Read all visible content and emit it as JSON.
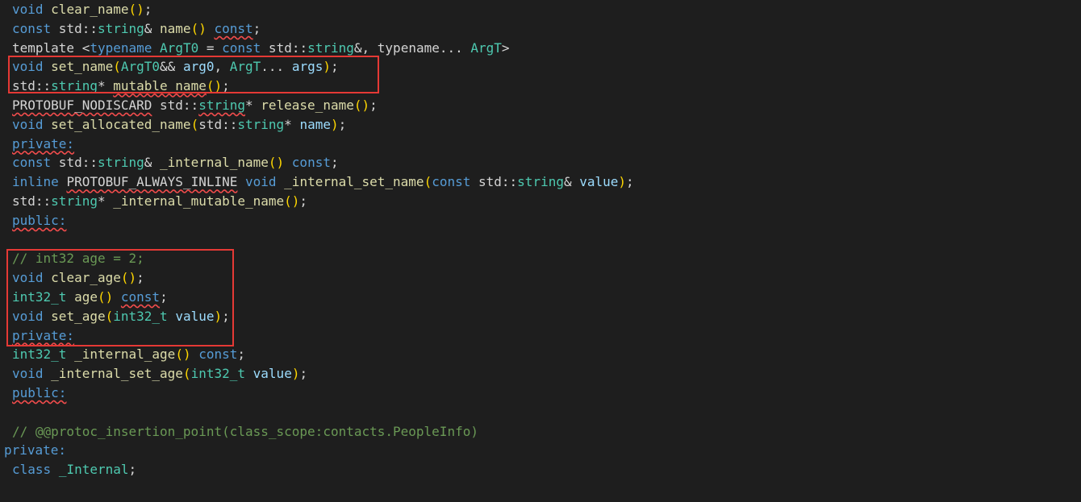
{
  "colors": {
    "background": "#1e1e1e",
    "keyword": "#569cd6",
    "type": "#4ec9b0",
    "function": "#dcdcaa",
    "variable": "#9cdcfe",
    "number": "#b5cea8",
    "comment": "#6a9955",
    "plain": "#d4d4d4",
    "bracket": "#ffd700",
    "bracket_nested": "#da70d6",
    "highlight_box": "#e53935",
    "squiggle": "#f14c4c"
  },
  "code_lines": [
    {
      "indent": 1,
      "tokens": [
        {
          "t": "void",
          "c": "kw"
        },
        {
          "t": " ",
          "c": "plain"
        },
        {
          "t": "clear_name",
          "c": "fn"
        },
        {
          "t": "()",
          "c": "paren"
        },
        {
          "t": ";",
          "c": "plain"
        }
      ]
    },
    {
      "indent": 1,
      "tokens": [
        {
          "t": "const",
          "c": "kw"
        },
        {
          "t": " std::",
          "c": "plain"
        },
        {
          "t": "string",
          "c": "type"
        },
        {
          "t": "& ",
          "c": "plain"
        },
        {
          "t": "name",
          "c": "fn"
        },
        {
          "t": "()",
          "c": "paren"
        },
        {
          "t": " ",
          "c": "plain"
        },
        {
          "t": "const",
          "c": "kw",
          "s": true
        },
        {
          "t": ";",
          "c": "plain"
        }
      ]
    },
    {
      "indent": 1,
      "tokens": [
        {
          "t": "template ",
          "c": "plain"
        },
        {
          "t": "<",
          "c": "plain"
        },
        {
          "t": "typename",
          "c": "kw"
        },
        {
          "t": " ",
          "c": "plain"
        },
        {
          "t": "ArgT0",
          "c": "type"
        },
        {
          "t": " = ",
          "c": "plain"
        },
        {
          "t": "const",
          "c": "kw"
        },
        {
          "t": " std::",
          "c": "plain"
        },
        {
          "t": "string",
          "c": "type"
        },
        {
          "t": "&, typename... ",
          "c": "plain"
        },
        {
          "t": "ArgT",
          "c": "type"
        },
        {
          "t": ">",
          "c": "plain"
        }
      ]
    },
    {
      "indent": 1,
      "tokens": [
        {
          "t": "void",
          "c": "kw"
        },
        {
          "t": " ",
          "c": "plain"
        },
        {
          "t": "set_name",
          "c": "fn"
        },
        {
          "t": "(",
          "c": "paren"
        },
        {
          "t": "ArgT0",
          "c": "type"
        },
        {
          "t": "&& ",
          "c": "plain"
        },
        {
          "t": "arg0",
          "c": "var"
        },
        {
          "t": ", ",
          "c": "plain"
        },
        {
          "t": "ArgT",
          "c": "type"
        },
        {
          "t": "... ",
          "c": "plain"
        },
        {
          "t": "args",
          "c": "var"
        },
        {
          "t": ")",
          "c": "paren"
        },
        {
          "t": ";",
          "c": "plain"
        }
      ]
    },
    {
      "indent": 1,
      "tokens": [
        {
          "t": "std::",
          "c": "plain"
        },
        {
          "t": "string",
          "c": "type"
        },
        {
          "t": "* ",
          "c": "plain"
        },
        {
          "t": "mutable_name",
          "c": "fn",
          "s": true
        },
        {
          "t": "()",
          "c": "paren"
        },
        {
          "t": ";",
          "c": "plain"
        }
      ]
    },
    {
      "indent": 1,
      "tokens": [
        {
          "t": "PROTOBUF_NODISCARD",
          "c": "plain",
          "s": true
        },
        {
          "t": " std::",
          "c": "plain"
        },
        {
          "t": "string",
          "c": "type",
          "s": true
        },
        {
          "t": "* ",
          "c": "plain"
        },
        {
          "t": "release_name",
          "c": "fn"
        },
        {
          "t": "()",
          "c": "paren"
        },
        {
          "t": ";",
          "c": "plain"
        }
      ]
    },
    {
      "indent": 1,
      "tokens": [
        {
          "t": "void",
          "c": "kw"
        },
        {
          "t": " ",
          "c": "plain"
        },
        {
          "t": "set_allocated_name",
          "c": "fn"
        },
        {
          "t": "(",
          "c": "paren"
        },
        {
          "t": "std::",
          "c": "plain"
        },
        {
          "t": "string",
          "c": "type"
        },
        {
          "t": "* ",
          "c": "plain"
        },
        {
          "t": "name",
          "c": "var"
        },
        {
          "t": ")",
          "c": "paren"
        },
        {
          "t": ";",
          "c": "plain"
        }
      ]
    },
    {
      "indent": 1,
      "tokens": [
        {
          "t": "private:",
          "c": "kw",
          "s": true
        }
      ]
    },
    {
      "indent": 1,
      "tokens": [
        {
          "t": "const",
          "c": "kw"
        },
        {
          "t": " std::",
          "c": "plain"
        },
        {
          "t": "string",
          "c": "type"
        },
        {
          "t": "& ",
          "c": "plain"
        },
        {
          "t": "_internal_name",
          "c": "fn"
        },
        {
          "t": "()",
          "c": "paren"
        },
        {
          "t": " ",
          "c": "plain"
        },
        {
          "t": "const",
          "c": "kw"
        },
        {
          "t": ";",
          "c": "plain"
        }
      ]
    },
    {
      "indent": 1,
      "tokens": [
        {
          "t": "inline",
          "c": "kw"
        },
        {
          "t": " ",
          "c": "plain"
        },
        {
          "t": "PROTOBUF_ALWAYS_INLINE",
          "c": "plain",
          "s": true
        },
        {
          "t": " ",
          "c": "plain"
        },
        {
          "t": "void",
          "c": "kw"
        },
        {
          "t": " ",
          "c": "plain"
        },
        {
          "t": "_internal_set_name",
          "c": "fn"
        },
        {
          "t": "(",
          "c": "paren"
        },
        {
          "t": "const",
          "c": "kw"
        },
        {
          "t": " std::",
          "c": "plain"
        },
        {
          "t": "string",
          "c": "type"
        },
        {
          "t": "& ",
          "c": "plain"
        },
        {
          "t": "value",
          "c": "var"
        },
        {
          "t": ")",
          "c": "paren"
        },
        {
          "t": ";",
          "c": "plain"
        }
      ]
    },
    {
      "indent": 1,
      "tokens": [
        {
          "t": "std::",
          "c": "plain"
        },
        {
          "t": "string",
          "c": "type"
        },
        {
          "t": "* ",
          "c": "plain"
        },
        {
          "t": "_internal_mutable_name",
          "c": "fn"
        },
        {
          "t": "()",
          "c": "paren"
        },
        {
          "t": ";",
          "c": "plain"
        }
      ]
    },
    {
      "indent": 1,
      "tokens": [
        {
          "t": "public:",
          "c": "kw",
          "s": true
        }
      ]
    },
    {
      "indent": 0,
      "tokens": []
    },
    {
      "indent": 1,
      "tokens": [
        {
          "t": "// int32 age = 2;",
          "c": "cmt"
        }
      ]
    },
    {
      "indent": 1,
      "tokens": [
        {
          "t": "void",
          "c": "kw"
        },
        {
          "t": " ",
          "c": "plain"
        },
        {
          "t": "clear_age",
          "c": "fn"
        },
        {
          "t": "()",
          "c": "paren"
        },
        {
          "t": ";",
          "c": "plain"
        }
      ]
    },
    {
      "indent": 1,
      "tokens": [
        {
          "t": "int32_t",
          "c": "type"
        },
        {
          "t": " ",
          "c": "plain"
        },
        {
          "t": "age",
          "c": "fn"
        },
        {
          "t": "()",
          "c": "paren"
        },
        {
          "t": " ",
          "c": "plain"
        },
        {
          "t": "const",
          "c": "kw",
          "s": true
        },
        {
          "t": ";",
          "c": "plain"
        }
      ]
    },
    {
      "indent": 1,
      "tokens": [
        {
          "t": "void",
          "c": "kw"
        },
        {
          "t": " ",
          "c": "plain"
        },
        {
          "t": "set_age",
          "c": "fn"
        },
        {
          "t": "(",
          "c": "paren"
        },
        {
          "t": "int32_t",
          "c": "type"
        },
        {
          "t": " ",
          "c": "plain"
        },
        {
          "t": "value",
          "c": "var"
        },
        {
          "t": ")",
          "c": "paren"
        },
        {
          "t": ";",
          "c": "plain"
        }
      ]
    },
    {
      "indent": 1,
      "tokens": [
        {
          "t": "private:",
          "c": "kw",
          "s": true
        }
      ]
    },
    {
      "indent": 1,
      "tokens": [
        {
          "t": "int32_t",
          "c": "type"
        },
        {
          "t": " ",
          "c": "plain"
        },
        {
          "t": "_internal_age",
          "c": "fn"
        },
        {
          "t": "()",
          "c": "paren"
        },
        {
          "t": " ",
          "c": "plain"
        },
        {
          "t": "const",
          "c": "kw"
        },
        {
          "t": ";",
          "c": "plain"
        }
      ]
    },
    {
      "indent": 1,
      "tokens": [
        {
          "t": "void",
          "c": "kw"
        },
        {
          "t": " ",
          "c": "plain"
        },
        {
          "t": "_internal_set_age",
          "c": "fn"
        },
        {
          "t": "(",
          "c": "paren"
        },
        {
          "t": "int32_t",
          "c": "type"
        },
        {
          "t": " ",
          "c": "plain"
        },
        {
          "t": "value",
          "c": "var"
        },
        {
          "t": ")",
          "c": "paren"
        },
        {
          "t": ";",
          "c": "plain"
        }
      ]
    },
    {
      "indent": 1,
      "tokens": [
        {
          "t": "public:",
          "c": "kw",
          "s": true
        }
      ]
    },
    {
      "indent": 0,
      "tokens": []
    },
    {
      "indent": 1,
      "tokens": [
        {
          "t": "// @@protoc_insertion_point(class_scope:contacts.PeopleInfo)",
          "c": "cmt"
        }
      ]
    },
    {
      "indent": 0,
      "tokens": [
        {
          "t": "private:",
          "c": "kw"
        }
      ]
    },
    {
      "indent": 1,
      "tokens": [
        {
          "t": "class",
          "c": "kw"
        },
        {
          "t": " ",
          "c": "plain"
        },
        {
          "t": "_Internal",
          "c": "type"
        },
        {
          "t": ";",
          "c": "plain"
        }
      ]
    }
  ]
}
